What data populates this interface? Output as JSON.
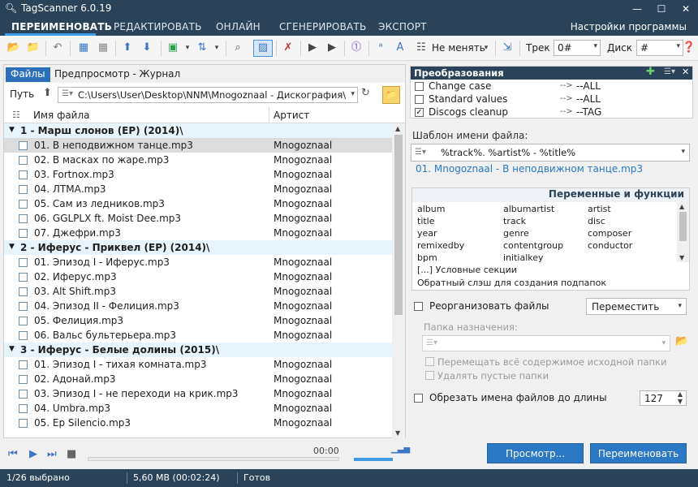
{
  "window": {
    "title": "TagScanner 6.0.19",
    "minimize": "—",
    "maximize": "☐",
    "close": "✕"
  },
  "tabs": [
    {
      "label": "ПЕРЕИМЕНОВАТЬ"
    },
    {
      "label": "РЕДАКТИРОВАТЬ"
    },
    {
      "label": "ОНЛАЙН"
    },
    {
      "label": "СГЕНЕРИРОВАТЬ"
    },
    {
      "label": "ЭКСПОРТ"
    }
  ],
  "settings_label": "Настройки программы",
  "toolbar": {
    "case_mode": "Не менять",
    "track_label": "Трек",
    "track_value": "0#",
    "disc_label": "Диск",
    "disc_value": "#"
  },
  "left": {
    "tab_files": "Файлы",
    "tab_other": "Предпросмотр - Журнал",
    "path_label": "Путь",
    "path_value": "C:\\Users\\User\\Desktop\\NNM\\Mnogoznaal - Дискография\\",
    "col_name": "Имя файла",
    "col_artist": "Артист",
    "groups": [
      {
        "title": "1 - Марш слонов (EP) (2014)\\",
        "files": [
          {
            "name": "01. В неподвижном танце.mp3",
            "artist": "Mnogoznaal"
          },
          {
            "name": "02. В масках по жаре.mp3",
            "artist": "Mnogoznaal"
          },
          {
            "name": "03. Fortnox.mp3",
            "artist": "Mnogoznaal"
          },
          {
            "name": "04. ЛТМА.mp3",
            "artist": "Mnogoznaal"
          },
          {
            "name": "05. Сам из ледников.mp3",
            "artist": "Mnogoznaal"
          },
          {
            "name": "06. GGLPLX ft. Moist Dee.mp3",
            "artist": "Mnogoznaal"
          },
          {
            "name": "07. Джефри.mp3",
            "artist": "Mnogoznaal"
          }
        ]
      },
      {
        "title": "2 - Иферус - Приквел (EP) (2014)\\",
        "files": [
          {
            "name": "01. Эпизод I - Иферус.mp3",
            "artist": "Mnogoznaal"
          },
          {
            "name": "02. Иферус.mp3",
            "artist": "Mnogoznaal"
          },
          {
            "name": "03. Alt Shift.mp3",
            "artist": "Mnogoznaal"
          },
          {
            "name": "04. Эпизод II - Фелиция.mp3",
            "artist": "Mnogoznaal"
          },
          {
            "name": "05. Фелиция.mp3",
            "artist": "Mnogoznaal"
          },
          {
            "name": "06. Вальс бультерьера.mp3",
            "artist": "Mnogoznaal"
          }
        ]
      },
      {
        "title": "3 - Иферус - Белые долины (2015)\\",
        "files": [
          {
            "name": "01. Эпизод I - тихая комната.mp3",
            "artist": "Mnogoznaal"
          },
          {
            "name": "02. Адонай.mp3",
            "artist": "Mnogoznaal"
          },
          {
            "name": "03. Эпизод I - не переходи на крик.mp3",
            "artist": "Mnogoznaal"
          },
          {
            "name": "04. Umbra.mp3",
            "artist": "Mnogoznaal"
          },
          {
            "name": "05. Ep Silencio.mp3",
            "artist": "Mnogoznaal"
          }
        ]
      }
    ]
  },
  "player": {
    "time": "00:00",
    "progress": 0
  },
  "status": {
    "selected": "1/26 выбрано",
    "size": "5,60 MB (00:02:24)",
    "state": "Готов"
  },
  "right": {
    "transforms_title": "Преобразования",
    "transforms": [
      {
        "name": "Change case",
        "arrow": "-->",
        "value": "--ALL",
        "checked": false
      },
      {
        "name": "Standard values",
        "arrow": "-->",
        "value": "--ALL",
        "checked": false
      },
      {
        "name": "Discogs cleanup",
        "arrow": "-->",
        "value": "--TAG",
        "checked": true
      }
    ],
    "template_label": "Шаблон имени файла:",
    "template_value": "%track%. %artist% - %title%",
    "preview": "01. Mnogoznaal - В неподвижном танце.mp3",
    "vars_title": "Переменные и функции",
    "vars": [
      [
        "album",
        "albumartist",
        "artist"
      ],
      [
        "title",
        "track",
        "disc"
      ],
      [
        "year",
        "genre",
        "composer"
      ],
      [
        "remixedby",
        "contentgroup",
        "conductor"
      ],
      [
        "bpm",
        "initialkey",
        ""
      ]
    ],
    "vars_cond": "[...] Условные секции",
    "vars_slash": "Обратный слэш для создания подпапок",
    "reorg_label": "Реорганизовать файлы",
    "move_mode": "Переместить",
    "dest_label": "Папка назначения:",
    "opt_move_all": "Перемещать всё содержимое исходной папки",
    "opt_delete_empty": "Удалять пустые папки",
    "trunc_label": "Обрезать имена файлов до длины",
    "trunc_value": "127",
    "btn_preview": "Просмотр...",
    "btn_rename": "Переименовать"
  }
}
